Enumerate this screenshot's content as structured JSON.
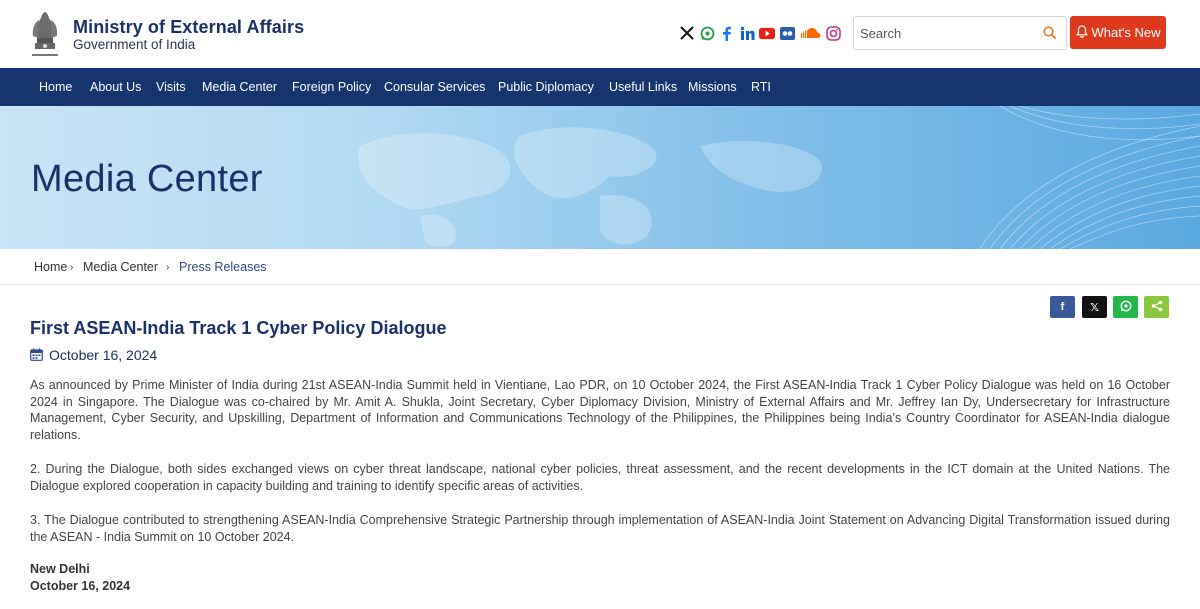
{
  "header": {
    "title": "Ministry of External Affairs",
    "subtitle": "Government of India",
    "search_placeholder": "Search",
    "whats_new": "What's New",
    "social_icons": [
      "x-icon",
      "whatsapp-icon",
      "facebook-icon",
      "linkedin-icon",
      "youtube-icon",
      "flickr-icon",
      "soundcloud-icon",
      "instagram-icon"
    ]
  },
  "nav": {
    "items": [
      "Home",
      "About Us",
      "Visits",
      "Media Center",
      "Foreign Policy",
      "Consular Services",
      "Public Diplomacy",
      "Useful Links",
      "Missions",
      "RTI"
    ]
  },
  "banner": {
    "title": "Media Center"
  },
  "breadcrumb": {
    "home": "Home",
    "section": "Media Center",
    "current": "Press Releases"
  },
  "share": {
    "facebook": "f",
    "twitter": "𝕏"
  },
  "article": {
    "title": "First ASEAN-India Track 1 Cyber Policy Dialogue",
    "date": "October 16, 2024",
    "paragraphs": [
      "As announced by Prime Minister of India during 21st ASEAN-India Summit held in Vientiane, Lao PDR, on 10 October 2024, the First ASEAN-India Track 1 Cyber Policy Dialogue was held on 16 October 2024 in Singapore. The Dialogue was co-chaired by Mr. Amit A. Shukla, Joint Secretary, Cyber Diplomacy Division, Ministry of External Affairs and Mr. Jeffrey Ian Dy, Undersecretary for Infrastructure Management, Cyber Security, and Upskilling, Department of Information and Communications Technology of the Philippines, the Philippines being India’s Country Coordinator for ASEAN-India dialogue relations.",
      "2. During the Dialogue, both sides exchanged views on cyber threat landscape, national cyber policies, threat assessment, and the recent developments in the ICT domain at the United Nations. The Dialogue explored cooperation in capacity building and training to identify specific areas of activities.",
      "3. The Dialogue contributed to strengthening ASEAN-India Comprehensive Strategic Partnership through implementation of ASEAN-India Joint Statement on Advancing Digital Transformation issued during the ASEAN - India Summit on 10 October 2024."
    ],
    "place": "New Delhi",
    "sign_date": "October 16, 2024"
  },
  "colors": {
    "brand": "#1b3068",
    "nav": "#16346d",
    "accent": "#e03a1e"
  }
}
